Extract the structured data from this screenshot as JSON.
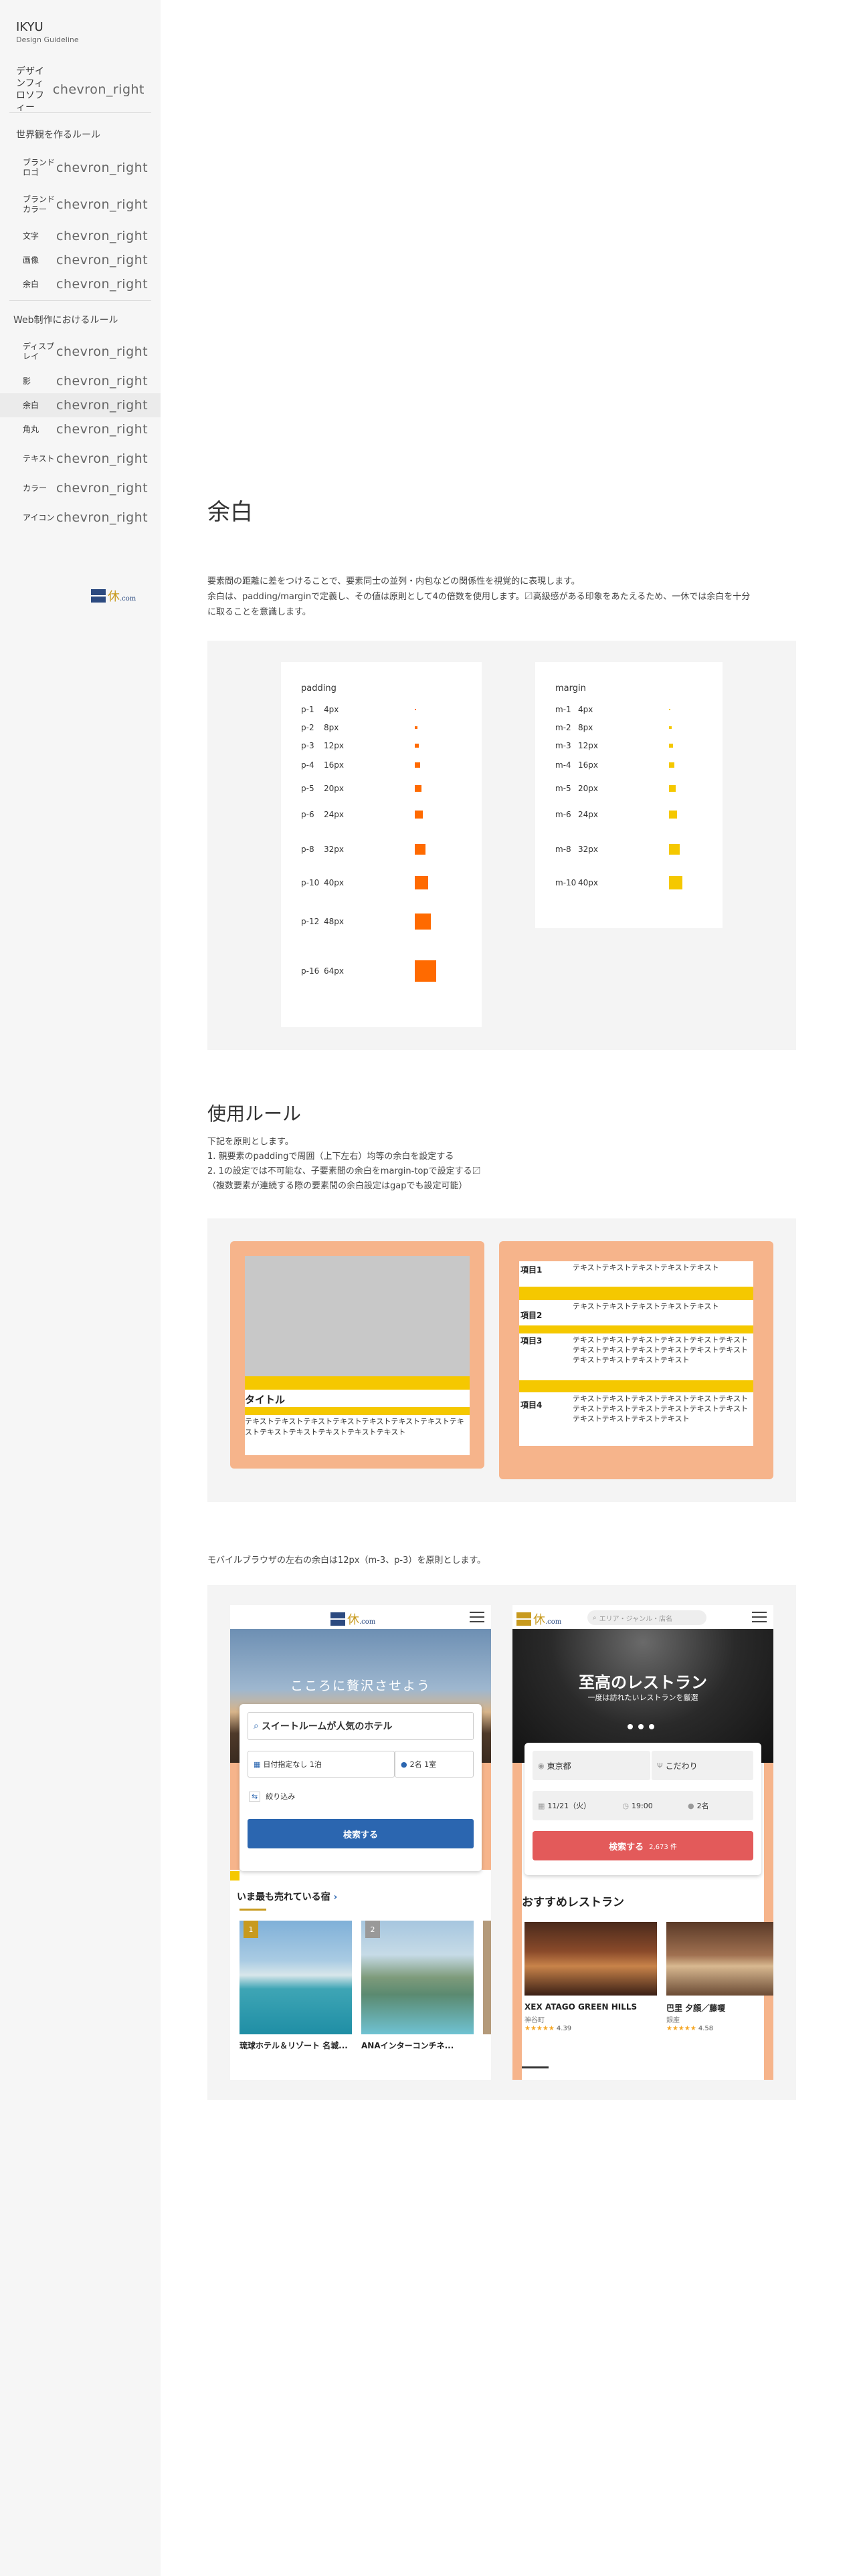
{
  "sidebar": {
    "brand": "IKYU",
    "brand_sub": "Design Guideline",
    "chevron": "chevron_right",
    "philosophy": "デザインフィロソフィー",
    "world_title": "世界観を作るルール",
    "world_items": [
      "ブランドロゴ",
      "ブランドカラー",
      "文字",
      "画像",
      "余白"
    ],
    "web_title": "Web制作におけるルール",
    "web_items": [
      "ディスプレイ",
      "影",
      "余白",
      "角丸",
      "テキスト",
      "カラー",
      "アイコン"
    ],
    "logo_text": "休",
    "logo_com": ".com"
  },
  "main": {
    "title": "余白",
    "intro_lines": [
      "要素間の距離に差をつけることで、要素同士の並列・内包などの関係性を視覚的に表現します。",
      "余白は、padding/marginで定義し、その値は原則として4の倍数を使用します。〼高級感がある印象をあたえるため、一休では余白を十分",
      "に取ることを意識します。"
    ],
    "padding_card": {
      "title": "padding",
      "rows": [
        {
          "name": "p-1",
          "value": "4px"
        },
        {
          "name": "p-2",
          "value": "8px"
        },
        {
          "name": "p-3",
          "value": "12px"
        },
        {
          "name": "p-4",
          "value": "16px"
        },
        {
          "name": "p-5",
          "value": "20px"
        },
        {
          "name": "p-6",
          "value": "24px"
        },
        {
          "name": "p-8",
          "value": "32px"
        },
        {
          "name": "p-10",
          "value": "40px"
        },
        {
          "name": "p-12",
          "value": "48px"
        },
        {
          "name": "p-16",
          "value": "64px"
        }
      ]
    },
    "margin_card": {
      "title": "margin",
      "rows": [
        {
          "name": "m-1",
          "value": "4px"
        },
        {
          "name": "m-2",
          "value": "8px"
        },
        {
          "name": "m-3",
          "value": "12px"
        },
        {
          "name": "m-4",
          "value": "16px"
        },
        {
          "name": "m-5",
          "value": "20px"
        },
        {
          "name": "m-6",
          "value": "24px"
        },
        {
          "name": "m-8",
          "value": "32px"
        },
        {
          "name": "m-10",
          "value": "40px"
        }
      ]
    },
    "usage_title": "使用ルール",
    "usage_lines": [
      "下記を原則とします。",
      "1. 親要素のpaddingで周囲（上下左右）均等の余白を設定する",
      "2. 1の設定では不可能な、子要素間の余白をmargin-topで設定する〼",
      "（複数要素が連続する際の要素間の余白設定はgapでも設定可能）"
    ],
    "example_card": {
      "title": "タイトル",
      "text": "テキストテキストテキストテキストテキストテキストテキストテキストテキストテキストテキストテキストテキスト"
    },
    "example_list": {
      "items": [
        {
          "name": "項目1",
          "text": "テキストテキストテキストテキストテキスト"
        },
        {
          "name": "項目2",
          "text": "テキストテキストテキストテキストテキスト"
        },
        {
          "name": "項目3",
          "text": "テキストテキストテキストテキストテキストテキストテキストテキストテキストテキストテキストテキストテキストテキストテキストテキスト"
        },
        {
          "name": "項目4",
          "text": "テキストテキストテキストテキストテキストテキストテキストテキストテキストテキストテキストテキストテキストテキストテキストテキスト"
        }
      ]
    },
    "mobile_note": "モバイルブラウザの左右の余白は12px（m-3、p-3）を原則とします。"
  },
  "phone1": {
    "logo": "休",
    "logo_com": ".com",
    "hero_text": "こころに贅沢させよう",
    "search_placeholder": "スイートルームが人気のホテル",
    "date": "日付指定なし 1泊",
    "guests": "2名 1室",
    "filter": "絞り込み",
    "search_btn": "検索する",
    "section": "いま最も売れている宿",
    "hotels": [
      {
        "rank": "1",
        "name": "琉球ホテル＆リゾート 名城..."
      },
      {
        "rank": "2",
        "name": "ANAインターコンチネ..."
      }
    ]
  },
  "phone2": {
    "logo": "休",
    "logo_com": ".com",
    "search_placeholder": "エリア・ジャンル・店名",
    "hero_title": "至高のレストラン",
    "hero_sub": "一度は訪れたいレストランを厳選",
    "area": "東京都",
    "pref": "こだわり",
    "date": "11/21（火）",
    "time": "19:00",
    "people": "2名",
    "search_btn": "検索する",
    "count": "2,673 件",
    "section": "おすすめレストラン",
    "restaurants": [
      {
        "name": "XEX ATAGO GREEN HILLS",
        "area": "神谷町",
        "rating": "4.39"
      },
      {
        "name": "巴里 夕顔／藤嗄",
        "area": "銀座",
        "rating": "4.58"
      }
    ]
  },
  "colors": {
    "accent_orange": "#ff6a00",
    "accent_yellow": "#f5c800",
    "salmon": "#f6b48b",
    "brand_blue": "#2c4a80",
    "button_blue": "#2b66b0",
    "button_red": "#e35a5a"
  }
}
